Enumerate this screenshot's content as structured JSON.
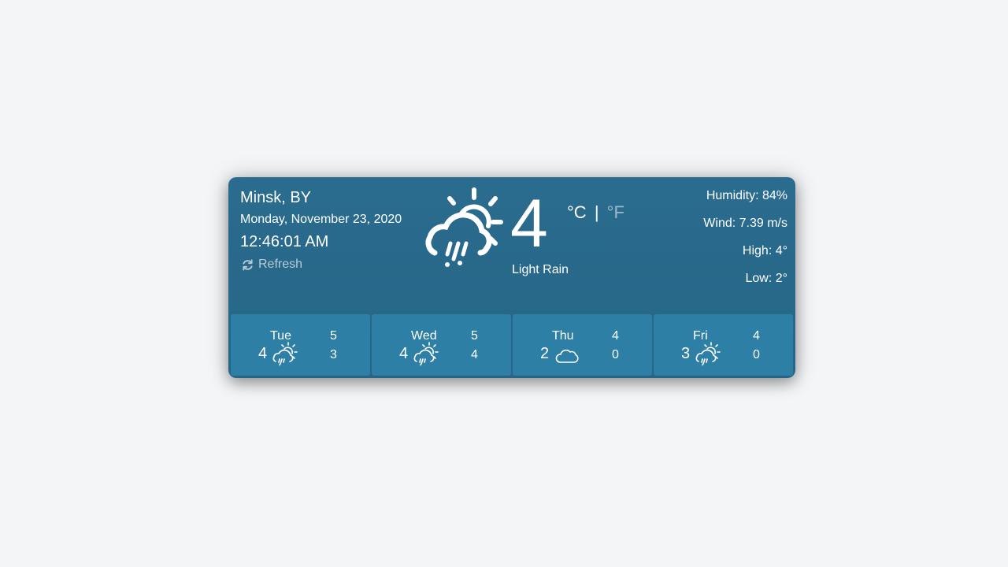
{
  "location": {
    "city": "Minsk, BY",
    "date": "Monday, November 23, 2020",
    "time": "12:46:01 AM",
    "refresh_label": "Refresh"
  },
  "current": {
    "temperature": "4",
    "unit_c": "°C",
    "unit_separator": "|",
    "unit_f": "°F",
    "active_unit": "C",
    "condition": "Light Rain",
    "icon": "sun-cloud-rain-icon"
  },
  "details": {
    "humidity": "Humidity: 84%",
    "wind": "Wind: 7.39 m/s",
    "high": "High: 4°",
    "low": "Low: 2°"
  },
  "forecast": [
    {
      "day": "Tue",
      "temp": "4",
      "high": "5",
      "low": "3",
      "icon": "sun-cloud-rain-icon"
    },
    {
      "day": "Wed",
      "temp": "4",
      "high": "5",
      "low": "4",
      "icon": "sun-cloud-rain-icon"
    },
    {
      "day": "Thu",
      "temp": "2",
      "high": "4",
      "low": "0",
      "icon": "cloud-icon"
    },
    {
      "day": "Fri",
      "temp": "3",
      "high": "4",
      "low": "0",
      "icon": "sun-cloud-rain-icon"
    }
  ],
  "colors": {
    "background": "#f4f5f7",
    "widget": "#2a6c8f",
    "forecast_card": "#2d7fa5",
    "inactive_unit": "#9cb8c9"
  }
}
